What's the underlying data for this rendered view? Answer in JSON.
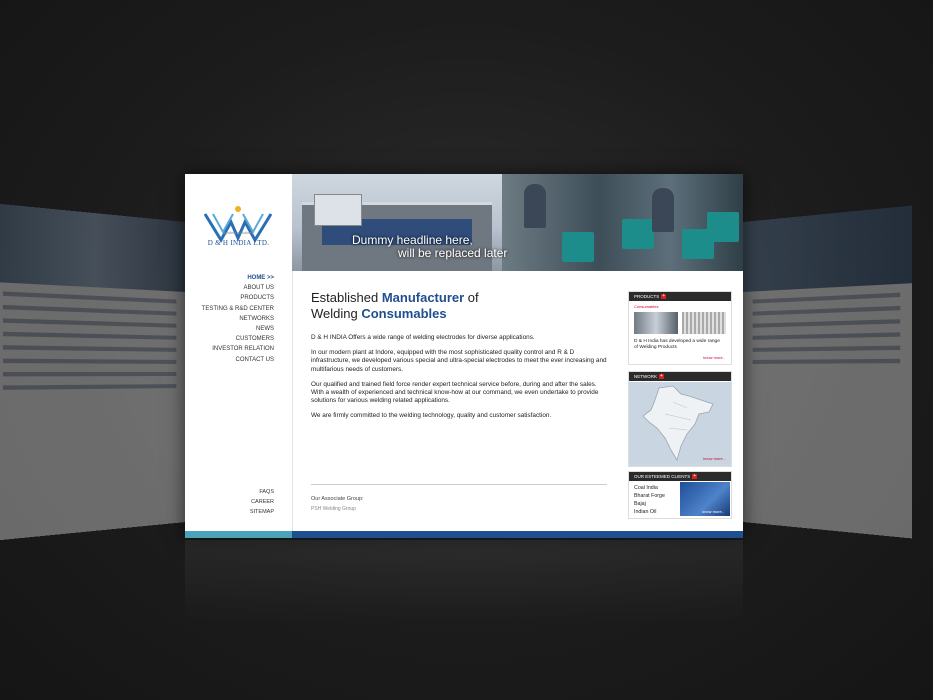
{
  "site": {
    "company": "D & H INDIA LTD.",
    "tagline": "igniting solutions"
  },
  "nav": {
    "items": [
      "HOME >>",
      "ABOUT US",
      "PRODUCTS",
      "TESTING & R&D CENTER",
      "NETWORKS",
      "NEWS",
      "CUSTOMERS",
      "INVESTOR RELATION",
      "CONTACT US"
    ],
    "footer_items": [
      "FAQS",
      "CAREER",
      "SITEMAP"
    ]
  },
  "banner": {
    "headline_line1": "Dummy headline here,",
    "headline_line2": "will be replaced later"
  },
  "main": {
    "heading_part1": "Established ",
    "heading_em1": "Manufacturer",
    "heading_part2": " of",
    "heading_part3": "Welding ",
    "heading_em2": "Consumables",
    "paragraphs": [
      "D & H INDIA Offers a wide range of welding electrodes for diverse applications.",
      "In our modern plant at Indore, equipped with the most sophisticated quality control and R & D infrastructure, we developed various special and ultra-special electrodes to meet the ever increasing and multifarious needs of customers.",
      "Our qualified and trained field force render expert technical service before, during and after the sales. With a wealth of experienced and technical know-how at our command, we even undertake to provide solutions for various welding related applications.",
      "We are firmly committed to the welding technology, quality and customer satisfaction."
    ],
    "associate_label": "Our Associate Group:",
    "associate_link": "PSH Welding Group"
  },
  "widgets": {
    "products": {
      "title": "PRODUCTS",
      "sub": "Consumables",
      "desc": "D & H India has developed a wide range of Welding Products",
      "more": "know more.."
    },
    "network": {
      "title": "NETWORK",
      "more": "know more.."
    },
    "clients": {
      "title": "OUR ESTEEMED CLIENTS",
      "list": [
        "Coal India",
        "Bharat Forge",
        "Bajaj",
        "Indian Oil"
      ],
      "more": "know more.."
    }
  },
  "colors": {
    "brand_blue": "#1f4f8f",
    "accent_red": "#d62020",
    "footer_teal": "#4aa3b8"
  }
}
